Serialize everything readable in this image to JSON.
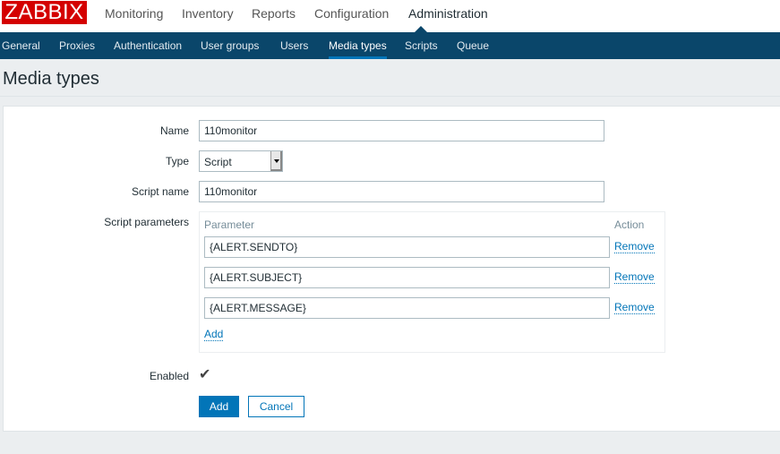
{
  "logo": "ZABBIX",
  "main_menu": [
    "Monitoring",
    "Inventory",
    "Reports",
    "Configuration",
    "Administration"
  ],
  "sub_menu": [
    "General",
    "Proxies",
    "Authentication",
    "User groups",
    "Users",
    "Media types",
    "Scripts",
    "Queue"
  ],
  "page_title": "Media types",
  "form": {
    "name_label": "Name",
    "name_value": "110monitor",
    "type_label": "Type",
    "type_value": "Script",
    "script_name_label": "Script name",
    "script_name_value": "110monitor",
    "params_label": "Script parameters",
    "param_header": "Parameter",
    "action_header": "Action",
    "params": [
      "{ALERT.SENDTO}",
      "{ALERT.SUBJECT}",
      "{ALERT.MESSAGE}"
    ],
    "remove_label": "Remove",
    "add_link": "Add",
    "enabled_label": "Enabled",
    "enabled": true,
    "add_button": "Add",
    "cancel_button": "Cancel"
  },
  "colors": {
    "brand": "#d40000",
    "nav": "#0a466a",
    "accent": "#0275b8"
  }
}
